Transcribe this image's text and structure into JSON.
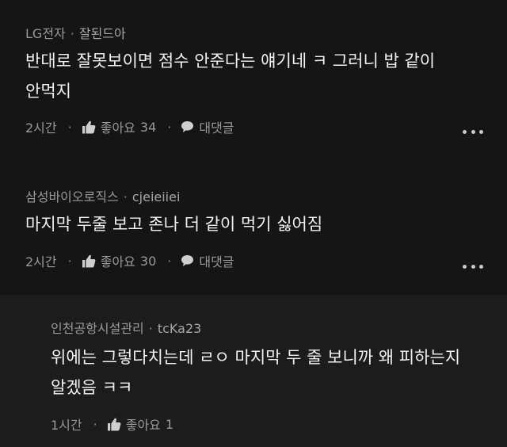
{
  "comments": [
    {
      "company": "LG전자",
      "nickname": "잘된드아",
      "text_lines": [
        "반대로 잘못보이면 점수 안준다는 얘기네 ㅋ 그러니 밥 같이",
        "안먹지"
      ],
      "time": "2시간",
      "like_label": "좋아요",
      "like_count": "34",
      "reply_label": "대댓글"
    },
    {
      "company": "삼성바이오로직스",
      "nickname": "cjeieiiei",
      "text_lines": [
        "마지막 두줄 보고 존나 더 같이 먹기 싫어짐"
      ],
      "time": "2시간",
      "like_label": "좋아요",
      "like_count": "30",
      "reply_label": "대댓글"
    }
  ],
  "reply": {
    "company": "인천공항시설관리",
    "nickname": "tcKa23",
    "text_lines": [
      "위에는 그렇다치는데 ㄹㅇ 마지막 두 줄 보니까 왜 피하는지",
      "알겠음 ㅋㅋ"
    ],
    "time": "1시간",
    "like_label": "좋아요",
    "like_count": "1"
  },
  "separator_dot": "·",
  "icons": {
    "like": "thumbs-up-icon",
    "reply": "speech-bubble-icon",
    "more": "more-options-icon"
  },
  "colors": {
    "background": "#151515",
    "reply_background": "#1c1c1c",
    "text": "#f2f2f2",
    "meta": "#9a9a9a"
  }
}
